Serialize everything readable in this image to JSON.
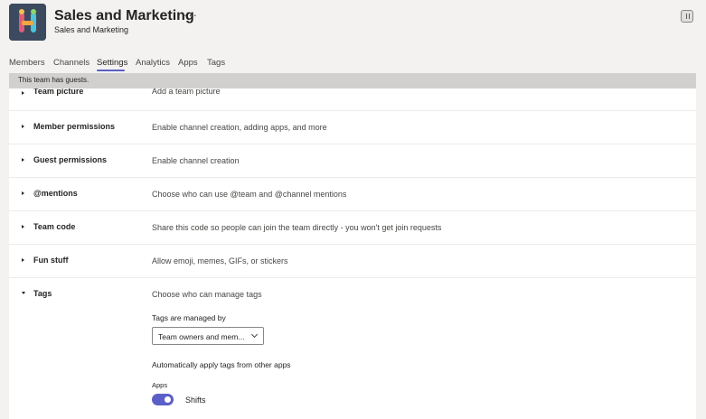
{
  "header": {
    "title": "Sales and Marketing",
    "subtitle": "Sales and Marketing",
    "more_glyph": "···"
  },
  "tabs": [
    {
      "label": "Members"
    },
    {
      "label": "Channels"
    },
    {
      "label": "Settings",
      "active": true
    },
    {
      "label": "Analytics"
    },
    {
      "label": "Apps"
    },
    {
      "label": "Tags"
    }
  ],
  "banner": {
    "text": "This team has guests."
  },
  "settings": {
    "rows": [
      {
        "title": "Team picture",
        "desc": "Add a team picture"
      },
      {
        "title": "Member permissions",
        "desc": "Enable channel creation, adding apps, and more"
      },
      {
        "title": "Guest permissions",
        "desc": "Enable channel creation"
      },
      {
        "title": "@mentions",
        "desc": "Choose who can use @team and @channel mentions"
      },
      {
        "title": "Team code",
        "desc": "Share this code so people can join the team directly - you won't get join requests"
      },
      {
        "title": "Fun stuff",
        "desc": "Allow emoji, memes, GIFs, or stickers"
      },
      {
        "title": "Tags",
        "desc": "Choose who can manage tags",
        "expanded": true
      }
    ],
    "tags": {
      "managed_label": "Tags are managed by",
      "managed_value": "Team owners and mem...",
      "auto_label": "Automatically apply tags from other apps",
      "apps_label": "Apps",
      "app_name": "Shifts",
      "app_enabled": true
    }
  },
  "colors": {
    "accent": "#5b5fc7",
    "banner": "#d2d0ce",
    "background": "#f3f2f1"
  },
  "icons": [
    "team-avatar-icon",
    "more-options-icon",
    "info-pane-icon",
    "caret-right-icon",
    "caret-down-icon",
    "chevron-down-icon"
  ]
}
